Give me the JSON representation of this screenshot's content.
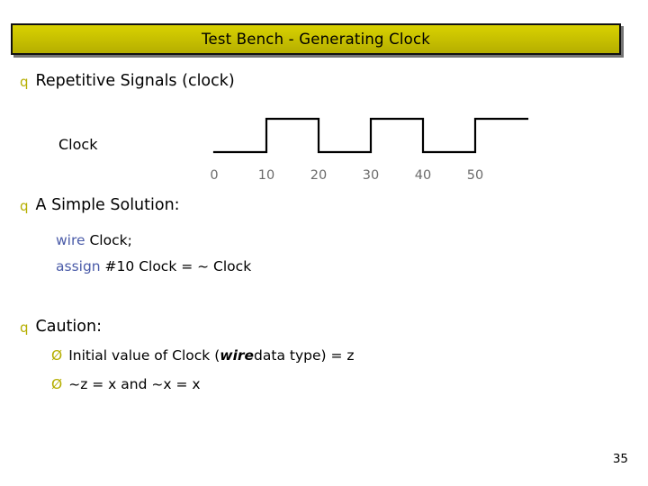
{
  "slide": {
    "title": "Test Bench - Generating Clock",
    "page_number": "35",
    "bullets": [
      {
        "marker": "q",
        "text": "Repetitive Signals (clock)"
      },
      {
        "marker": "q",
        "text": "A Simple Solution:"
      },
      {
        "marker": "q",
        "text": "Caution:"
      }
    ],
    "clock_label": "Clock",
    "waveform": {
      "tick_labels": [
        "0",
        "10",
        "20",
        "30",
        "40",
        "50"
      ],
      "tick_color": "#6b6b6b",
      "line_color": "#000000"
    },
    "code_lines": [
      {
        "keyword": "wire",
        "rest": " Clock;"
      },
      {
        "keyword": "assign",
        "rest": " #10 Clock = ~ Clock"
      }
    ],
    "sub_bullets": [
      {
        "marker": "Ø",
        "pre": "Initial value of Clock (",
        "emphasis": "wire",
        "post": " data type) = z"
      },
      {
        "marker": "Ø",
        "pre": "~z = x and ~x = x",
        "emphasis": "",
        "post": ""
      }
    ],
    "colors": {
      "title_bar": "#c9c200",
      "bullet_marker": "#b5ae00",
      "keyword": "#4a5ba8"
    }
  }
}
